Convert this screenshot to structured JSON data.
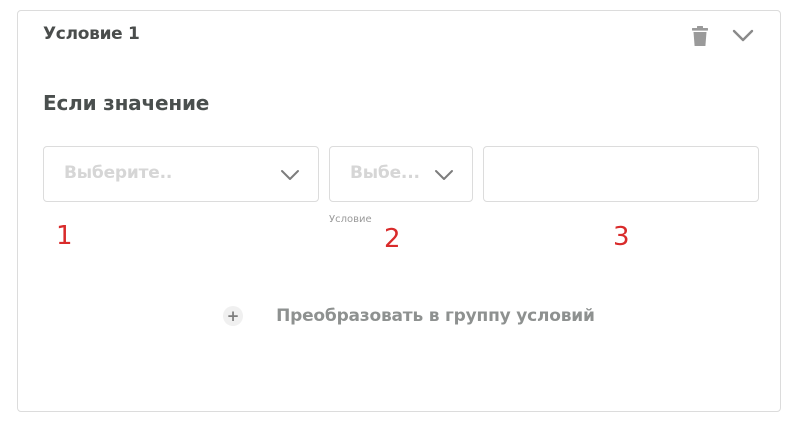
{
  "condition": {
    "title": "Условие 1",
    "icons": {
      "delete": "trash-icon",
      "collapse": "chevron-down-icon"
    },
    "section_title": "Если значение",
    "fields": [
      {
        "placeholder": "Выберите..",
        "icon": "chevron-down-icon"
      },
      {
        "placeholder": "Выбе...",
        "icon": "chevron-down-icon",
        "hint": "Условие"
      },
      {
        "value": ""
      }
    ],
    "annotations": [
      "1",
      "2",
      "3"
    ],
    "convert_label": "Преобразовать в группу условий",
    "convert_icon_glyph": "+"
  },
  "colors": {
    "annotation": "#d92b2b",
    "border": "#dcdcdc",
    "placeholder": "#d6d6d6",
    "title": "#4a4d4c",
    "muted_link": "#8e9190"
  }
}
